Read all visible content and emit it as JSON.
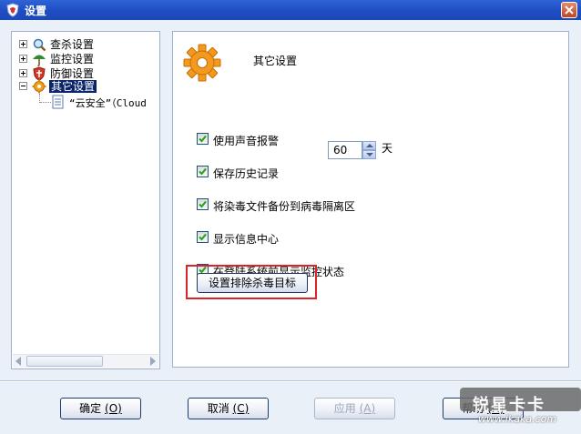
{
  "window": {
    "title": "设置"
  },
  "tree": {
    "items": [
      {
        "label": "查杀设置",
        "icon": "magnifier-icon"
      },
      {
        "label": "监控设置",
        "icon": "umbrella-icon"
      },
      {
        "label": "防御设置",
        "icon": "shield-icon"
      },
      {
        "label": "其它设置",
        "icon": "gear-icon",
        "selected": true
      }
    ],
    "child": {
      "label": "“云安全”（Cloud",
      "icon": "document-icon"
    }
  },
  "settings": {
    "section_title": "其它设置",
    "options": [
      {
        "label": "使用声音报警",
        "checked": true
      },
      {
        "label": "保存历史记录",
        "checked": true
      },
      {
        "label": "将染毒文件备份到病毒隔离区",
        "checked": true
      },
      {
        "label": "显示信息中心",
        "checked": true
      },
      {
        "label": "在登陆系统前显示监控状态",
        "checked": true
      }
    ],
    "history_days": "60",
    "history_unit": "天",
    "exclude_button": "设置排除杀毒目标"
  },
  "buttons": {
    "ok": {
      "label": "确定",
      "accel": "(O)"
    },
    "cancel": {
      "label": "取消",
      "accel": "(C)"
    },
    "apply": {
      "label": "应用",
      "accel": "(A)"
    },
    "help": {
      "label": "帮助",
      "accel": "(H)"
    }
  },
  "watermark": {
    "title": "锐星卡卡",
    "url": "www.ikaka.com"
  },
  "colors": {
    "titlebar": "#1f4fc4",
    "client_bg": "#eaf0f8",
    "selection": "#0a246a",
    "highlight_border": "#d9242a"
  }
}
